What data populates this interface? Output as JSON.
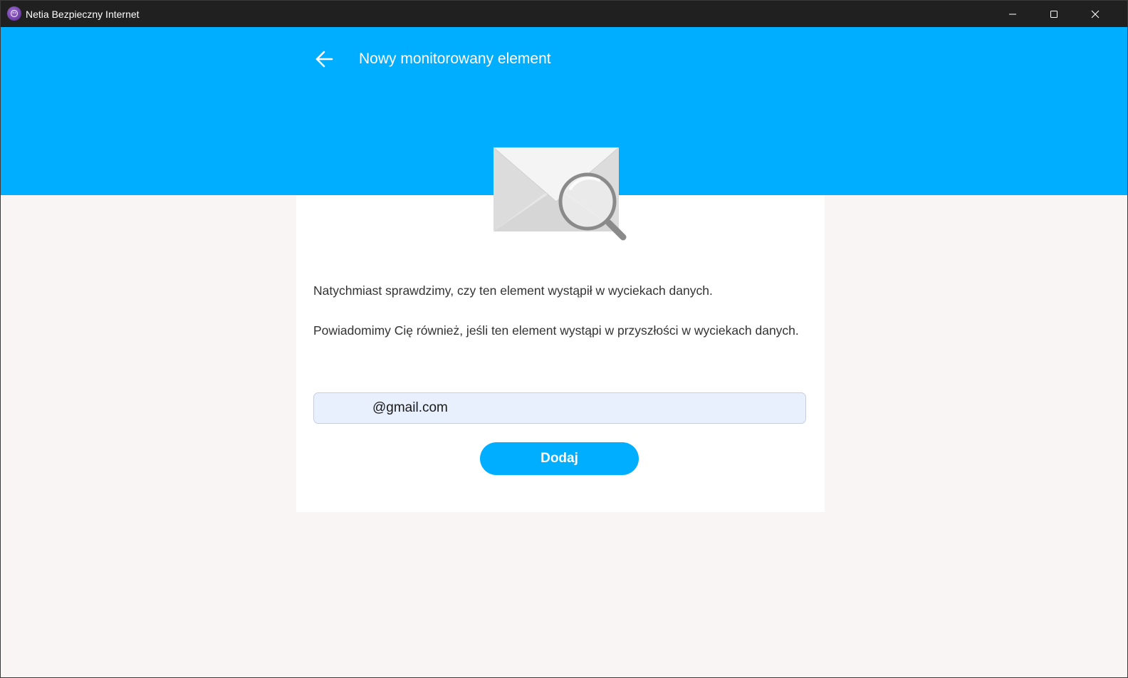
{
  "window": {
    "title": "Netia Bezpieczny Internet",
    "icon": "netia-app-icon",
    "controls": [
      "minimize-icon",
      "maximize-icon",
      "close-icon"
    ]
  },
  "header": {
    "back_icon": "arrow-left-icon",
    "title": "Nowy monitorowany element",
    "background_color": "#00aeff"
  },
  "illustration": {
    "icon": "envelope-magnifier-icon"
  },
  "main": {
    "paragraph1": "Natychmiast sprawdzimy, czy ten element wystąpił w wyciekach danych.",
    "paragraph2": "Powiadomimy Cię również, jeśli ten element wystąpi w przyszłości w wyciekach danych.",
    "email_input": {
      "value": "@gmail.com",
      "placeholder": ""
    },
    "add_button_label": "Dodaj"
  },
  "colors": {
    "accent": "#00aeff",
    "page_background": "#f8f5f4",
    "card_background": "#ffffff",
    "input_background": "#e8f0fe",
    "titlebar": "#202020"
  }
}
